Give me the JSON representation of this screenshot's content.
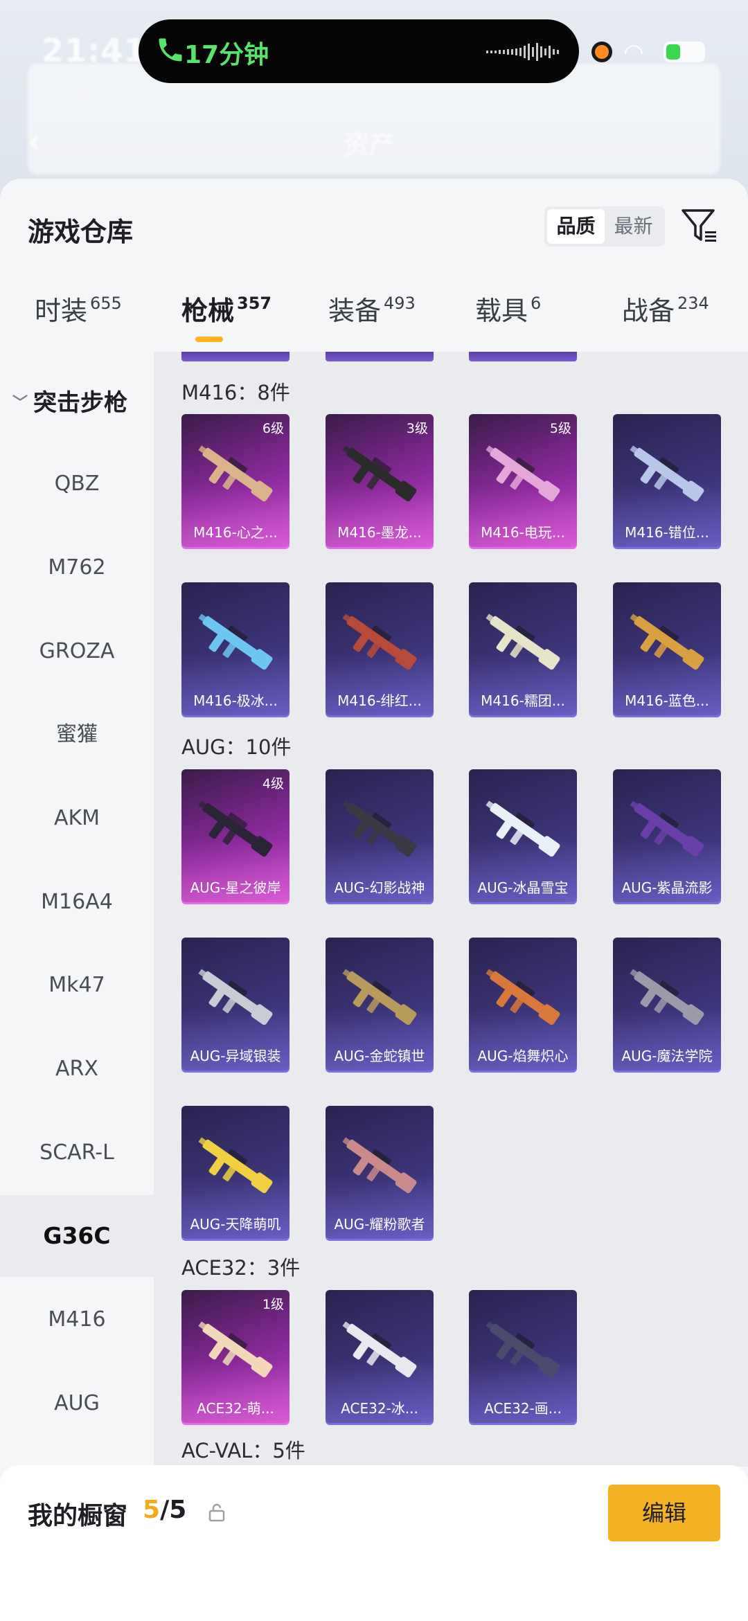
{
  "status_bar": {
    "time": "21:41",
    "call_duration": "17分钟"
  },
  "background_page": {
    "title": "资产",
    "back_icon": "chevron-left-icon"
  },
  "sheet": {
    "title": "游戏仓库",
    "sort_options": [
      "品质",
      "最新"
    ],
    "sort_selected": "品质",
    "filter_icon": "filter-icon"
  },
  "tabs": [
    {
      "label": "时装",
      "count": "655"
    },
    {
      "label": "枪械",
      "count": "357",
      "active": true
    },
    {
      "label": "装备",
      "count": "493"
    },
    {
      "label": "载具",
      "count": "6"
    },
    {
      "label": "战备",
      "count": "234"
    }
  ],
  "sidebar": {
    "category": "突击步枪",
    "items": [
      "QBZ",
      "M762",
      "GROZA",
      "蜜獾",
      "AKM",
      "M16A4",
      "Mk47",
      "ARX",
      "SCAR-L",
      "G36C",
      "M416",
      "AUG"
    ],
    "active_item": "G36C"
  },
  "groups": [
    {
      "title": "M416：8件",
      "items": [
        {
          "name": "M416-心之...",
          "level": "6级",
          "rarity": "pink"
        },
        {
          "name": "M416-墨龙...",
          "level": "3级",
          "rarity": "pink"
        },
        {
          "name": "M416-电玩...",
          "level": "5级",
          "rarity": "pink"
        },
        {
          "name": "M416-错位...",
          "level": "",
          "rarity": "purple"
        },
        {
          "name": "M416-极冰...",
          "level": "",
          "rarity": "purple"
        },
        {
          "name": "M416-绯红...",
          "level": "",
          "rarity": "purple"
        },
        {
          "name": "M416-糯团...",
          "level": "",
          "rarity": "purple"
        },
        {
          "name": "M416-蓝色...",
          "level": "",
          "rarity": "purple"
        }
      ]
    },
    {
      "title": "AUG：10件",
      "items": [
        {
          "name": "AUG-星之彼岸",
          "level": "4级",
          "rarity": "pink"
        },
        {
          "name": "AUG-幻影战神",
          "level": "",
          "rarity": "purple"
        },
        {
          "name": "AUG-冰晶雪宝",
          "level": "",
          "rarity": "purple"
        },
        {
          "name": "AUG-紫晶流影",
          "level": "",
          "rarity": "purple"
        },
        {
          "name": "AUG-异域银装",
          "level": "",
          "rarity": "purple"
        },
        {
          "name": "AUG-金蛇镇世",
          "level": "",
          "rarity": "purple"
        },
        {
          "name": "AUG-焰舞炽心",
          "level": "",
          "rarity": "purple"
        },
        {
          "name": "AUG-魔法学院",
          "level": "",
          "rarity": "purple"
        },
        {
          "name": "AUG-天降萌叽",
          "level": "",
          "rarity": "purple"
        },
        {
          "name": "AUG-耀粉歌者",
          "level": "",
          "rarity": "purple"
        }
      ]
    },
    {
      "title": "ACE32：3件",
      "items": [
        {
          "name": "ACE32-萌...",
          "level": "1级",
          "rarity": "pink"
        },
        {
          "name": "ACE32-冰...",
          "level": "",
          "rarity": "purple"
        },
        {
          "name": "ACE32-画...",
          "level": "",
          "rarity": "purple"
        }
      ]
    },
    {
      "title": "AC-VAL：5件",
      "items": []
    }
  ],
  "gun_colors": [
    "#d9b48a",
    "#2b2b2b",
    "#e4a8d8",
    "#b8c7e8",
    "#6cc6f0",
    "#b84a3a",
    "#e6e4c8",
    "#d9a040",
    "#2a2436",
    "#3a3a44",
    "#e8f0f8",
    "#6a3ea8",
    "#c8ccd4",
    "#b89a5a",
    "#d8783a",
    "#9a9aa8",
    "#f0d040",
    "#c88a8a",
    "#f0d8b8",
    "#e8e8f0",
    "#4a4a6a"
  ],
  "showcase": {
    "label": "我的橱窗",
    "current": "5",
    "total": "/5",
    "lock_icon": "lock-icon",
    "edit_label": "编辑"
  },
  "share_icon": "share-icon",
  "colors": {
    "accent": "#f3b224",
    "rarity_pink": "#c64ac8",
    "rarity_purple": "#514aa2",
    "call_green": "#59e36c"
  }
}
